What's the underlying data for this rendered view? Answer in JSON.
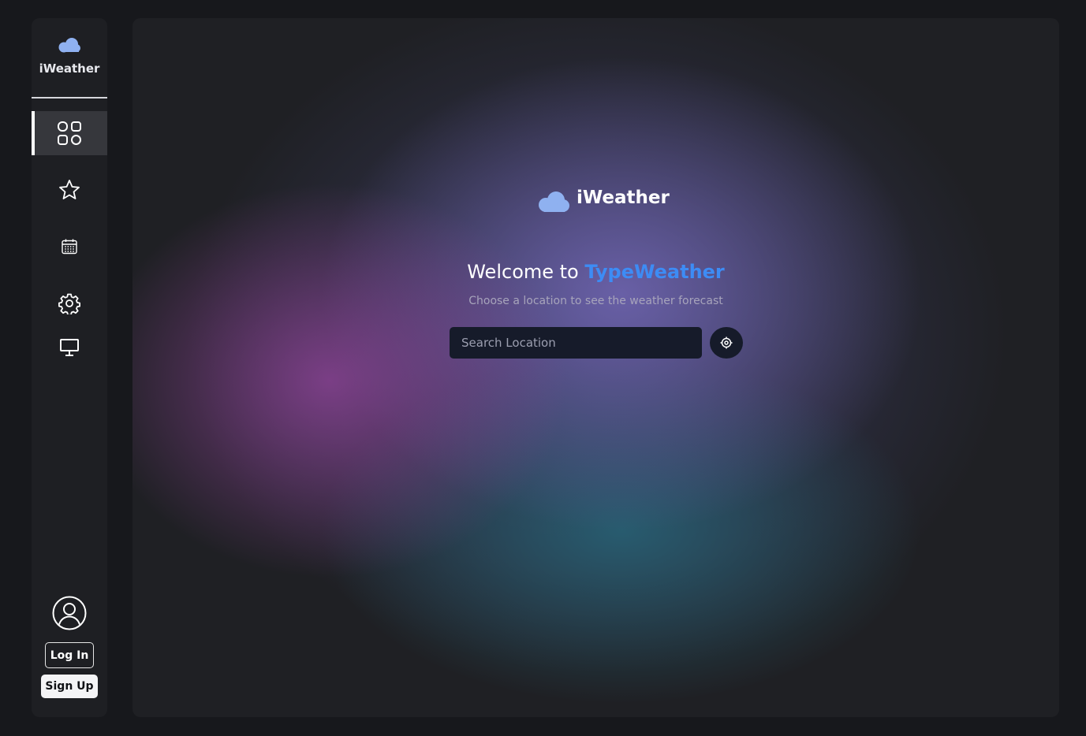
{
  "sidebar": {
    "brand_name": "iWeather",
    "logo_icon": "clouds-icon",
    "nav_items": [
      {
        "icon": "dashboard-grid-icon",
        "active": true
      },
      {
        "icon": "star-icon",
        "active": false
      },
      {
        "icon": "calendar-icon",
        "active": false
      },
      {
        "icon": "gear-icon",
        "active": false
      },
      {
        "icon": "monitor-icon",
        "active": false
      }
    ],
    "avatar_icon": "user-avatar-icon",
    "login_label": "Log In",
    "signup_label": "Sign Up"
  },
  "main": {
    "logo_name": "iWeather",
    "welcome_prefix": "Welcome to ",
    "welcome_brand": "TypeWeather",
    "subtitle": "Choose a location to see the weather forecast",
    "search_placeholder": "Search Location",
    "locate_icon": "crosshair-icon"
  },
  "colors": {
    "accent": "#3d8cf5",
    "logo": "#8fb1f0",
    "sidebar_bg": "#1e1f23",
    "input_bg": "#161b2a"
  }
}
